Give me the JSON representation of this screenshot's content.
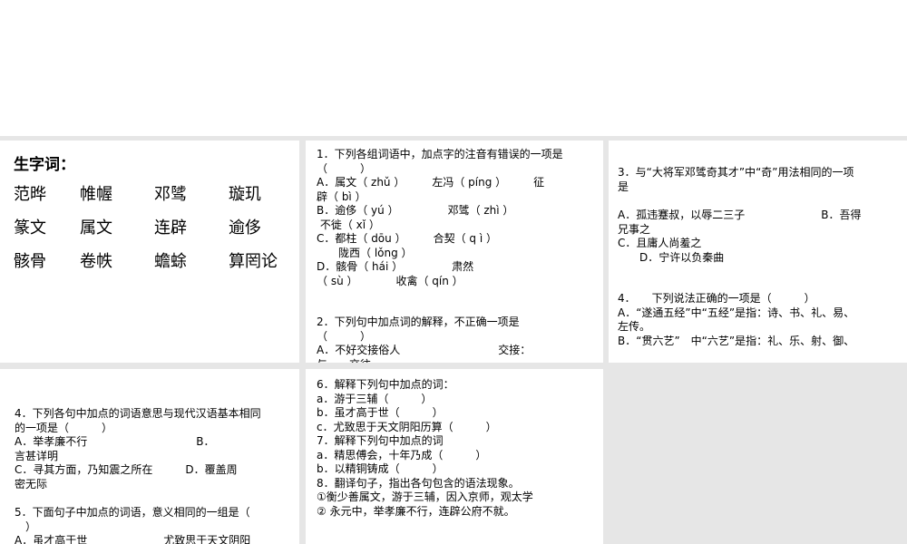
{
  "vocab": {
    "title": "生字词：",
    "words": [
      "范晔",
      "帷幄",
      "邓骘",
      "璇玑",
      "篆文",
      "属文",
      "连辟",
      "逾侈",
      "骸骨",
      "卷帙",
      "蟾蜍",
      "算罔论"
    ]
  },
  "q12": [
    "1．下列各组词语中，加点字的注音有错误的一项是",
    "（　　　）",
    "A．属文（ zhǔ ）　　　左冯（ píng ）　　　征",
    "辟（ bì ）",
    "B．逾侈（ yú ）　　　　　邓骘（ zhì ）",
    " 不徙（ xǐ ）",
    "C．都柱（ dōu ）　　　合契（ q ì ）",
    "　　陇西（ lǒng ）",
    "D．骸骨（ hái ）　　　　　肃然",
    "（ sù ）　　　　收禽（ qín ）",
    "2．下列句中加点词的解释，不正确一项是",
    "（　　　）",
    "A．不好交接俗人　　　　　　　　　交接：",
    "与……交往"
  ],
  "q34": [
    "3．与“大将军邓骘奇其才”中“奇”用法相同的一项",
    "是",
    "A．孤违蹇叔，以辱二三子　　　　　　　B．吾得",
    "兄事之",
    "C．且庸人尚羞之",
    "　　D．宁许以负秦曲",
    "4．　　下列说法正确的一项是（　　　）",
    "A．“遂通五经”中“五经”是指：诗、书、礼、易、",
    "左传。",
    "B．“贯六艺”　中“六艺”是指：礼、乐、射、御、"
  ],
  "q45": [
    "4．下列各句中加点的词语意思与现代汉语基本相同",
    "的一项是（　　　）",
    "A．举孝廉不行　　　　　　　　　　B．",
    "言甚详明",
    "C．寻其方面，乃知震之所在　　　D．覆盖周",
    "密无际",
    "5．下面句子中加点的词语，意义相同的一组是（",
    "　）",
    "A．虽才高于世　　　　　　　尤致思于天文阴阳"
  ],
  "q678": [
    "6．解释下列句中加点的词：",
    "a．游于三辅（　　　）",
    "b．虽才高于世（　　　）",
    "c．尤致思于天文阴阳历算（　　　）",
    "7．解释下列句中加点的词",
    "a．精思傅会，十年乃成（　　　）",
    "b．以精铜铸成（　　　）",
    "8．翻译句子，指出各句包含的语法现象。",
    "①衡少善属文，游于三辅，因入京师，观太学",
    "② 永元中，举孝廉不行，连辟公府不就。"
  ]
}
